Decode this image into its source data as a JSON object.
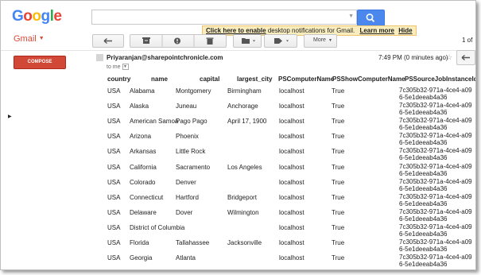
{
  "header": {
    "logo_letters": [
      "G",
      "o",
      "o",
      "g",
      "l",
      "e"
    ],
    "logo_colors": [
      "#4285f4",
      "#ea4335",
      "#fbbc05",
      "#4285f4",
      "#34a853",
      "#ea4335"
    ],
    "search_placeholder": ""
  },
  "notification": {
    "link_text": "Click here to enable",
    "message": " desktop notifications for Gmail.",
    "learn_more": "Learn more",
    "hide": "Hide"
  },
  "toolbar": {
    "gmail_label": "Gmail",
    "more_label": "More",
    "page_count": "1 of"
  },
  "sidebar": {
    "compose_label": "COMPOSE"
  },
  "message": {
    "sender": "Priyaranjan@sharepointchronicle.com",
    "to_me": "to me",
    "time": "7:49 PM (0 minutes ago)"
  },
  "table": {
    "headers": [
      "country",
      "name",
      "capital",
      "largest_city",
      "PSComputerName",
      "PSShowComputerName",
      "PSSourceJobInstanceId"
    ],
    "rows": [
      [
        "USA",
        "Alabama",
        "Montgomery",
        "Birmingham",
        "localhost",
        "True",
        "7c305b32-971a-4ce4-a096-5e1deeab4a36"
      ],
      [
        "USA",
        "Alaska",
        "Juneau",
        "Anchorage",
        "localhost",
        "True",
        "7c305b32-971a-4ce4-a096-5e1deeab4a36"
      ],
      [
        "USA",
        "American Samoa",
        "Pago Pago",
        "April 17, 1900",
        "localhost",
        "True",
        "7c305b32-971a-4ce4-a096-5e1deeab4a36"
      ],
      [
        "USA",
        "Arizona",
        "Phoenix",
        "",
        "localhost",
        "True",
        "7c305b32-971a-4ce4-a096-5e1deeab4a36"
      ],
      [
        "USA",
        "Arkansas",
        "Little Rock",
        "",
        "localhost",
        "True",
        "7c305b32-971a-4ce4-a096-5e1deeab4a36"
      ],
      [
        "USA",
        "California",
        "Sacramento",
        "Los Angeles",
        "localhost",
        "True",
        "7c305b32-971a-4ce4-a096-5e1deeab4a36"
      ],
      [
        "USA",
        "Colorado",
        "Denver",
        "",
        "localhost",
        "True",
        "7c305b32-971a-4ce4-a096-5e1deeab4a36"
      ],
      [
        "USA",
        "Connecticut",
        "Hartford",
        "Bridgeport",
        "localhost",
        "True",
        "7c305b32-971a-4ce4-a096-5e1deeab4a36"
      ],
      [
        "USA",
        "Delaware",
        "Dover",
        "Wilmington",
        "localhost",
        "True",
        "7c305b32-971a-4ce4-a096-5e1deeab4a36"
      ],
      [
        "USA",
        "District of Columbia",
        "",
        "",
        "localhost",
        "True",
        "7c305b32-971a-4ce4-a096-5e1deeab4a36"
      ],
      [
        "USA",
        "Florida",
        "Tallahassee",
        "Jacksonville",
        "localhost",
        "True",
        "7c305b32-971a-4ce4-a096-5e1deeab4a36"
      ],
      [
        "USA",
        "Georgia",
        "Atlanta",
        "",
        "localhost",
        "True",
        "7c305b32-971a-4ce4-a096-5e1deeab4a36"
      ]
    ]
  }
}
